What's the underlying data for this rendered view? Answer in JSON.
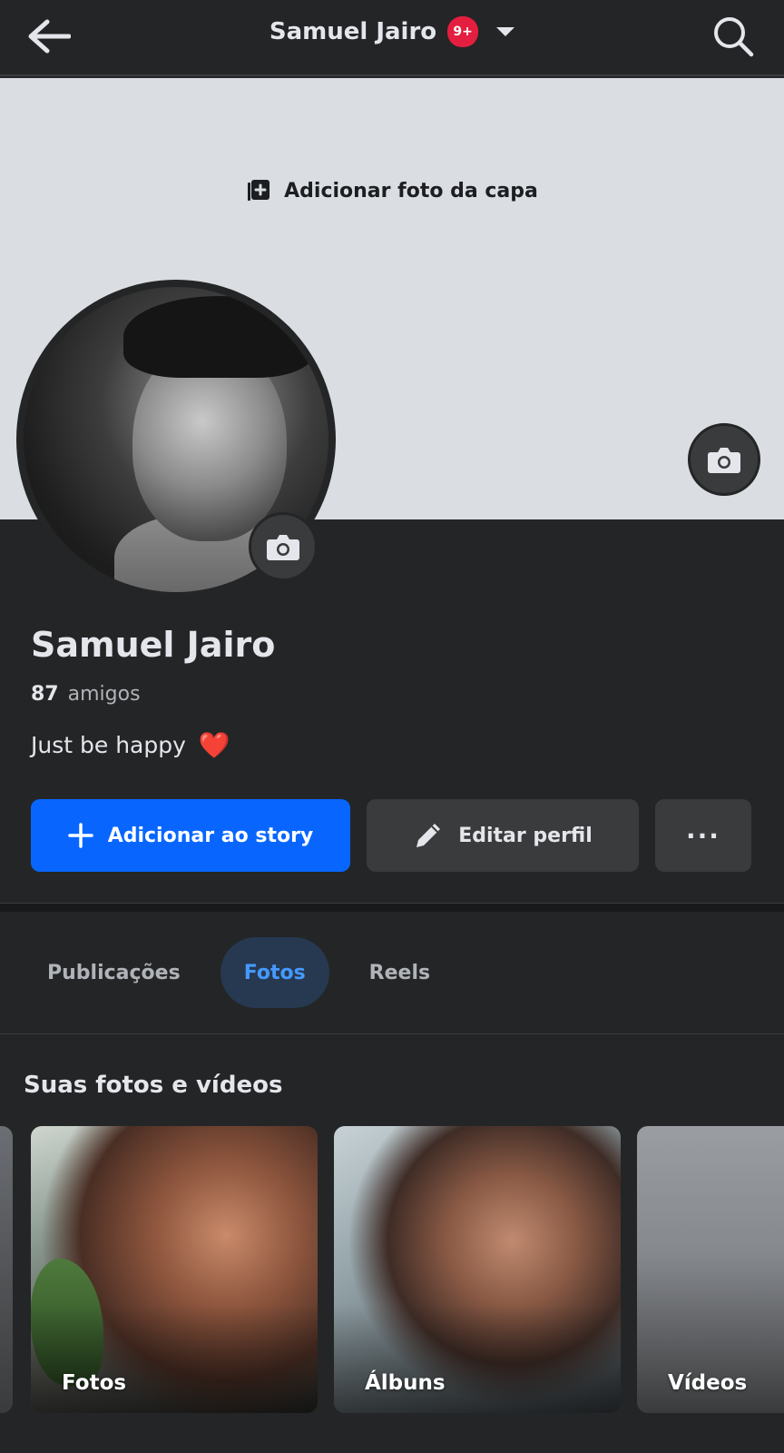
{
  "header": {
    "title": "Samuel Jairo",
    "notification_badge": "9+"
  },
  "cover": {
    "add_cover_label": "Adicionar foto da capa"
  },
  "profile": {
    "name": "Samuel Jairo",
    "friends_count": "87",
    "friends_label": "amigos",
    "bio": "Just be happy",
    "bio_emoji": "❤️"
  },
  "actions": {
    "add_story_label": "Adicionar ao story",
    "edit_profile_label": "Editar perfil",
    "more_label": "···"
  },
  "tabs": [
    {
      "label": "Publicações",
      "active": false
    },
    {
      "label": "Fotos",
      "active": true
    },
    {
      "label": "Reels",
      "active": false
    }
  ],
  "photos_section": {
    "title": "Suas fotos e vídeos",
    "cards": [
      {
        "label": "Fotos"
      },
      {
        "label": "Álbuns"
      },
      {
        "label": "Vídeos"
      }
    ]
  },
  "colors": {
    "background": "#242526",
    "primary_button": "#0866ff",
    "secondary_button": "#3a3b3c",
    "active_tab_bg": "#263951",
    "active_tab_text": "#4599ff",
    "badge": "#e41e3f",
    "cover": "#dadde1"
  }
}
